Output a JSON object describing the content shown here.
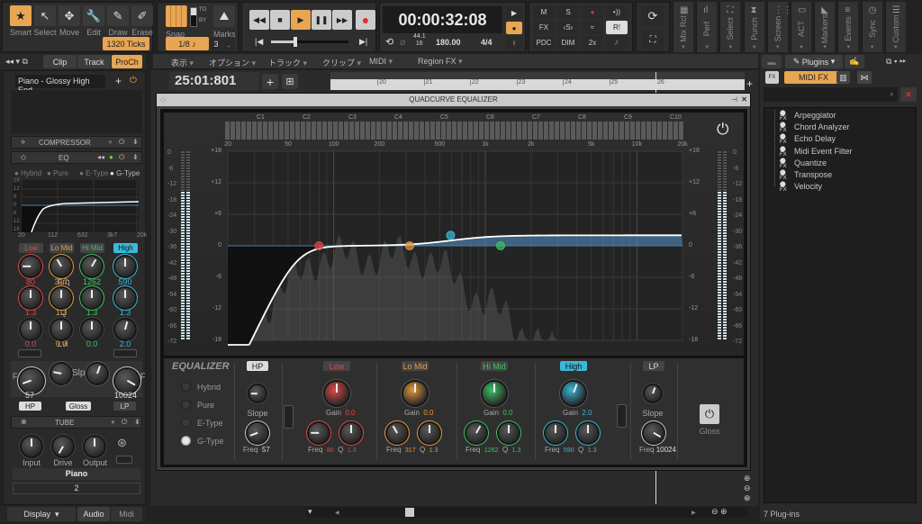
{
  "toolbar": {
    "tools": [
      {
        "label": "Smart",
        "icon": "★"
      },
      {
        "label": "Select",
        "icon": "↖"
      },
      {
        "label": "Move",
        "icon": "✥"
      },
      {
        "label": "Edit",
        "icon": "🔧"
      },
      {
        "label": "Draw",
        "icon": "✎"
      },
      {
        "label": "Erase",
        "icon": "✐"
      }
    ],
    "ticks": "1320 Ticks",
    "snap": "Snap",
    "to": "TO",
    "by": "BY",
    "marks": "Marks",
    "snap_value": "1/8",
    "snap_count": "3",
    "snap_dot": ".",
    "time": "00:00:32:08",
    "sample_rate": "44.1",
    "bit_depth": "16",
    "tempo": "180.00",
    "meter": "4/4",
    "mix_buttons": [
      "M",
      "S",
      "●",
      "•))",
      "FX",
      "‹S›",
      "≈",
      "R!",
      "PDC",
      "DIM",
      "2x",
      "✗"
    ],
    "modules": [
      "Mix Rcl",
      "Perf",
      "Select",
      "Punch",
      "Screen",
      "ACT",
      "Markers",
      "Events",
      "Sync",
      "Custom"
    ]
  },
  "inspector": {
    "tabs": [
      "Clip",
      "Track",
      "ProCh"
    ],
    "preset": "Piano - Glossy High End",
    "compressor": "COMPRESSOR",
    "eq": "EQ",
    "modes": [
      "Hybrid",
      "Pure",
      "E-Type",
      "G-Type"
    ],
    "mini_freqs": [
      "20",
      "112",
      "632",
      "3k7",
      "20k"
    ],
    "mini_db": [
      "18",
      "12",
      "6",
      "0",
      "6",
      "12",
      "18"
    ],
    "bands": [
      "Low",
      "Lo Mid",
      "Hi Mid",
      "High"
    ],
    "freqs": [
      "80",
      "317",
      "1262",
      "590"
    ],
    "frq": "Frq",
    "q": [
      "1.3",
      "1.3",
      "1.3",
      "1.3"
    ],
    "q_label": "Q",
    "lvl": [
      "0.0",
      "0.0",
      "0.0",
      "2.0"
    ],
    "lvl_label": "Lvl",
    "slp": "Slp",
    "f": "F",
    "hp_freq": "57",
    "lp_freq": "10024",
    "hp": "HP",
    "gloss": "Gloss",
    "lp": "LP",
    "tube": "TUBE",
    "tube_knobs": [
      "Input",
      "Drive",
      "Output"
    ],
    "track_name": "Piano",
    "track_num": "2",
    "bottom_tabs": [
      "Display",
      "Audio",
      "Midi"
    ]
  },
  "menu": [
    "表示",
    "オプション",
    "トラック",
    "クリップ",
    "MIDI",
    "Region FX"
  ],
  "timeline": {
    "position": "25:01:801",
    "ruler": [
      "20",
      "21",
      "22",
      "23",
      "24",
      "25",
      "26"
    ]
  },
  "eq_window": {
    "title": "QUADCURVE EQUALIZER",
    "notes": [
      "C1",
      "C2",
      "C3",
      "C4",
      "C5",
      "C6",
      "C7",
      "C8",
      "C9",
      "C10"
    ],
    "freq_labels": [
      "20",
      "50",
      "100",
      "200",
      "500",
      "1k",
      "2k",
      "5k",
      "10k",
      "20k"
    ],
    "db_labels": [
      "+18",
      "+12",
      "+6",
      "0",
      "-6",
      "-12",
      "-18"
    ],
    "meter_labels": [
      "0",
      "-6",
      "-12",
      "-18",
      "-24",
      "-30",
      "-36",
      "-42",
      "-48",
      "-54",
      "-60",
      "-66",
      "-72"
    ],
    "equalizer_label": "EQUALIZER",
    "modes": [
      "Hybrid",
      "Pure",
      "E-Type",
      "G-Type"
    ],
    "active_mode": "G-Type",
    "hp": {
      "label": "HP",
      "slope": "Slope",
      "freq_label": "Freq",
      "freq": "57"
    },
    "bands": [
      {
        "label": "Low",
        "color": "#e04848",
        "gain": "0.0",
        "freq": "80",
        "q": "1.3",
        "freq_hz": 80,
        "gain_db": 0
      },
      {
        "label": "Lo Mid",
        "color": "#e39a3a",
        "gain": "0.0",
        "freq": "317",
        "q": "1.3",
        "freq_hz": 317,
        "gain_db": 0
      },
      {
        "label": "Hi Mid",
        "color": "#3cc463",
        "gain": "0.0",
        "freq": "1262",
        "q": "1.3",
        "freq_hz": 1262,
        "gain_db": 0
      },
      {
        "label": "High",
        "color": "#3ab8d8",
        "gain": "2.0",
        "freq": "590",
        "q": "1.3",
        "freq_hz": 590,
        "gain_db": 2
      }
    ],
    "gain_label": "Gain",
    "freq_label": "Freq",
    "q_label": "Q",
    "lp": {
      "label": "LP",
      "slope": "Slope",
      "freq_label": "Freq",
      "freq": "10024"
    },
    "gloss": "Gloss"
  },
  "browser": {
    "tab": "Plugins",
    "midi_fx": "MIDI FX",
    "fx": "FX",
    "plugins": [
      "Arpeggiator",
      "Chord Analyzer",
      "Echo Delay",
      "Midi Event Filter",
      "Quantize",
      "Transpose",
      "Velocity"
    ],
    "count": "7 Plug-ins"
  },
  "colors": {
    "accent": "#e8a552",
    "low": "#e04848",
    "lomid": "#e39a3a",
    "himid": "#3cc463",
    "high": "#3ab8d8"
  }
}
